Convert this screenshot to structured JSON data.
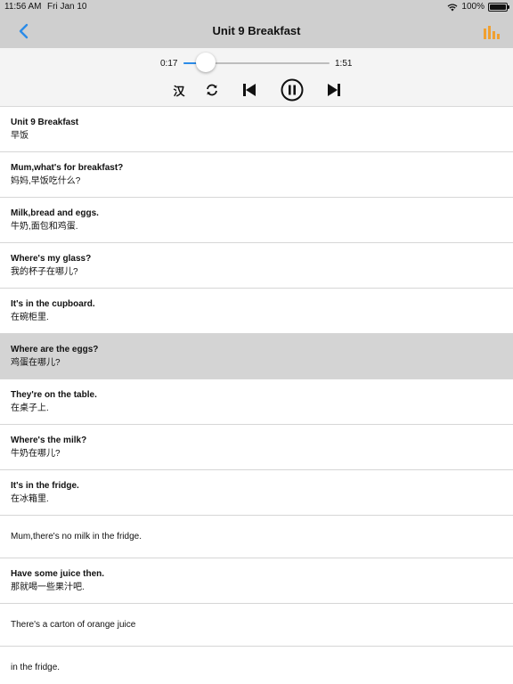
{
  "status": {
    "time": "11:56 AM",
    "date": "Fri Jan 10",
    "battery": "100%"
  },
  "nav": {
    "title": "Unit 9  Breakfast"
  },
  "player": {
    "current_time": "0:17",
    "total_time": "1:51",
    "progress": 0.153,
    "hanzi_label": "汉"
  },
  "colors": {
    "accent": "#2a8be8",
    "chart_icon": "#f0a030",
    "highlight_row": "#d4d4d4"
  },
  "rows": [
    {
      "en": "Unit 9 Breakfast",
      "zh": "早饭"
    },
    {
      "en": "Mum,what's for breakfast?",
      "zh": "妈妈,早饭吃什么?"
    },
    {
      "en": "Milk,bread and eggs.",
      "zh": "牛奶,面包和鸡蛋."
    },
    {
      "en": "Where's my glass?",
      "zh": "我的杯子在哪儿?"
    },
    {
      "en": "It's in the cupboard.",
      "zh": "在碗柜里."
    },
    {
      "en": "Where are the eggs?",
      "zh": "鸡蛋在哪儿?"
    },
    {
      "en": "They're on the table.",
      "zh": "在桌子上."
    },
    {
      "en": "Where's the milk?",
      "zh": "牛奶在哪儿?"
    },
    {
      "en": "It's in the fridge.",
      "zh": "在冰箱里."
    },
    {
      "en": "Mum,there's no milk in the fridge."
    },
    {
      "en": "Have some juice then.",
      "zh": "那就喝一些果汁吧."
    },
    {
      "en": "There's a carton of orange juice"
    },
    {
      "en": "in the fridge."
    }
  ]
}
